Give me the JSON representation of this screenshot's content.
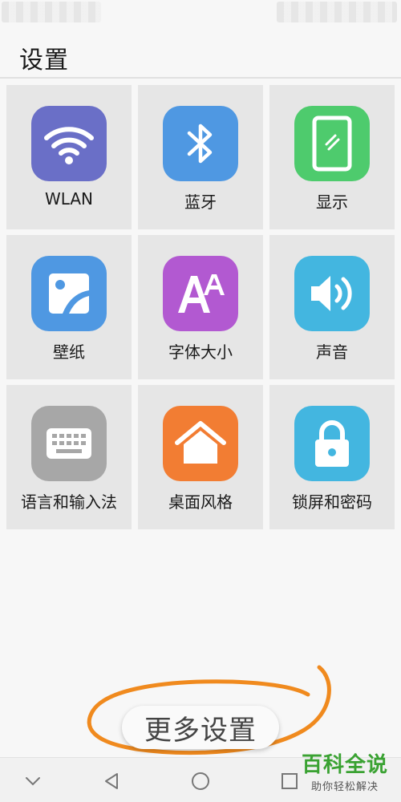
{
  "header": {
    "title": "设置"
  },
  "tiles": [
    {
      "label": "WLAN",
      "icon": "wifi-icon",
      "color": "#6a6fc7"
    },
    {
      "label": "蓝牙",
      "icon": "bluetooth-icon",
      "color": "#4f98e2"
    },
    {
      "label": "显示",
      "icon": "display-icon",
      "color": "#4ecb6d"
    },
    {
      "label": "壁纸",
      "icon": "wallpaper-icon",
      "color": "#4f98e2"
    },
    {
      "label": "字体大小",
      "icon": "font-size-icon",
      "color": "#b259d1"
    },
    {
      "label": "声音",
      "icon": "sound-icon",
      "color": "#43b6e0"
    },
    {
      "label": "语言和输入法",
      "icon": "keyboard-icon",
      "color": "#a7a7a7"
    },
    {
      "label": "桌面风格",
      "icon": "home-icon",
      "color": "#f27d33"
    },
    {
      "label": "锁屏和密码",
      "icon": "lock-icon",
      "color": "#43b6e0"
    }
  ],
  "more_settings": {
    "label": "更多设置"
  },
  "annotation": {
    "color": "#f08a1e"
  },
  "watermark": {
    "main": "百科全说",
    "sub": "助你轻松解决"
  }
}
